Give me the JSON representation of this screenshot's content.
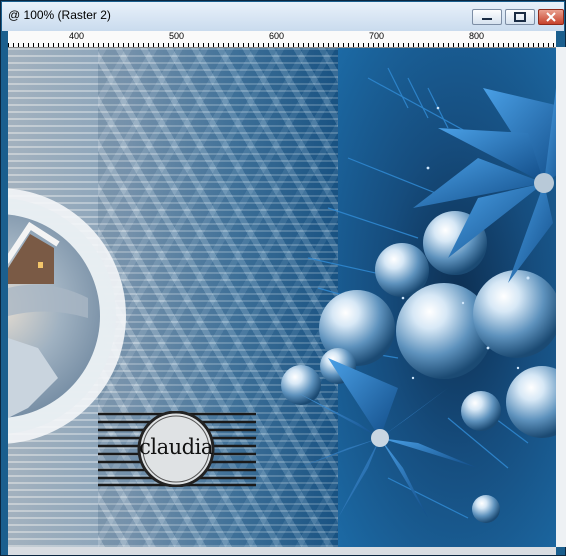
{
  "window": {
    "title": "@ 100% (Raster 2)"
  },
  "ruler": {
    "labels": [
      "400",
      "500",
      "600",
      "700",
      "800"
    ]
  },
  "artwork": {
    "watermark_name": "claudia",
    "description_icons": [
      "minimize-icon",
      "maximize-icon",
      "close-icon"
    ]
  },
  "colors": {
    "titlebar": "#dce8f5",
    "close_button": "#c7422b",
    "accent_blue": "#1c6aa5",
    "poinsettia": "#1f6cb4"
  }
}
